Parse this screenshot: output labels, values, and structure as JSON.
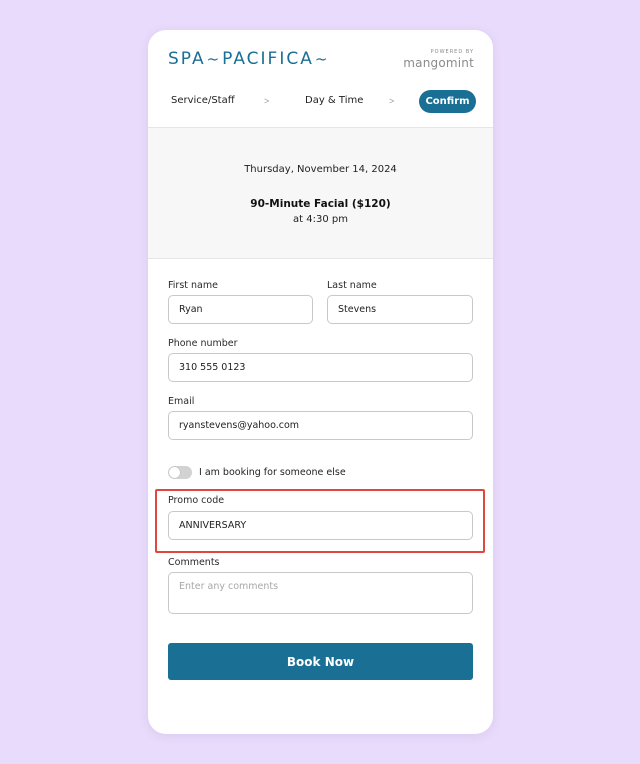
{
  "brand": {
    "part1": "SPA",
    "part2": "PACIFICA",
    "powered_by": "POWERED BY",
    "platform": "mangomint",
    "brand_color": "#1a6f95"
  },
  "steps": {
    "step1": "Service/Staff",
    "step2": "Day & Time",
    "separator": ">",
    "step3": "Confirm"
  },
  "summary": {
    "date": "Thursday, November 14, 2024",
    "service": "90-Minute Facial ($120)",
    "time": "at 4:30 pm"
  },
  "form": {
    "first_name_label": "First name",
    "first_name_value": "Ryan",
    "last_name_label": "Last name",
    "last_name_value": "Stevens",
    "phone_label": "Phone number",
    "phone_value": "310 555 0123",
    "email_label": "Email",
    "email_value": "ryanstevens@yahoo.com",
    "toggle_label": "I am booking for someone else",
    "toggle_on": false,
    "promo_label": "Promo code",
    "promo_value": "ANNIVERSARY",
    "comments_label": "Comments",
    "comments_placeholder": "Enter any comments",
    "submit_label": "Book Now"
  },
  "colors": {
    "background": "#e9dbfb",
    "accent": "#1a6f95",
    "highlight": "#e0473e"
  }
}
